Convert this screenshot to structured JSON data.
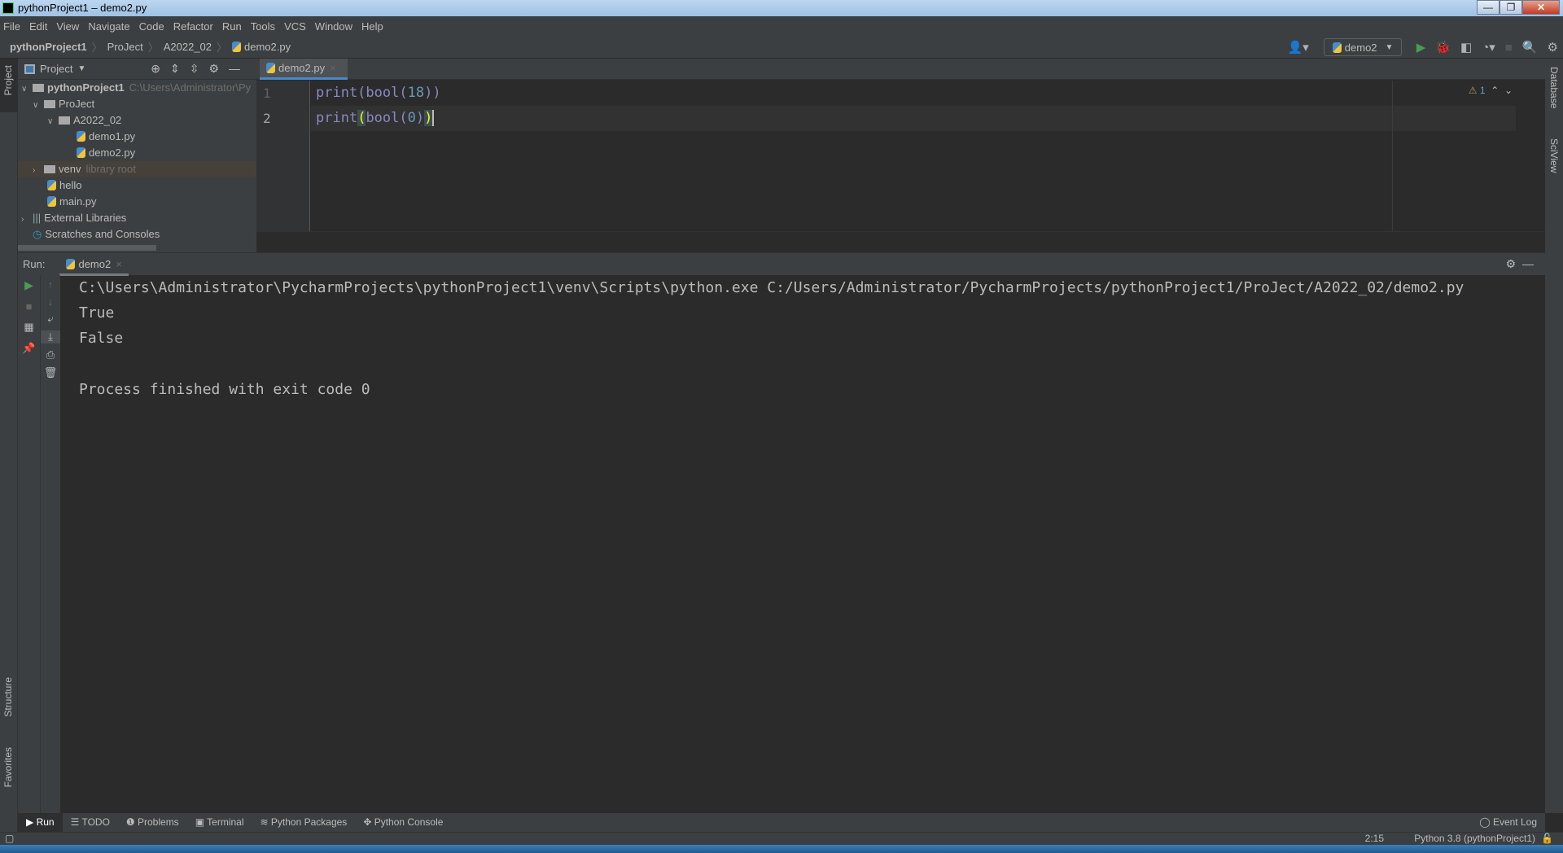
{
  "window": {
    "title": "pythonProject1 – demo2.py",
    "minimize": "—",
    "restore": "❐",
    "close": "✕"
  },
  "menu": [
    "File",
    "Edit",
    "View",
    "Navigate",
    "Code",
    "Refactor",
    "Run",
    "Tools",
    "VCS",
    "Window",
    "Help"
  ],
  "breadcrumb": [
    "pythonProject1",
    "ProJect",
    "A2022_02",
    "demo2.py"
  ],
  "toolbar": {
    "run_config": "demo2"
  },
  "project": {
    "title": "Project",
    "tree": [
      {
        "label": "pythonProject1",
        "hint": "C:\\Users\\Administrator\\Py"
      },
      {
        "label": "ProJect"
      },
      {
        "label": "A2022_02"
      },
      {
        "label": "demo1.py"
      },
      {
        "label": "demo2.py"
      },
      {
        "label": "venv",
        "hint": "library root"
      },
      {
        "label": "hello"
      },
      {
        "label": "main.py"
      },
      {
        "label": "External Libraries"
      },
      {
        "label": "Scratches and Consoles"
      }
    ]
  },
  "editor": {
    "tab": "demo2.py",
    "warnings": "1",
    "lines": [
      {
        "n": "1",
        "pre": "print(bool(",
        "arg": "18",
        "post": "))"
      },
      {
        "n": "2",
        "pre": "print",
        "open": "(",
        "mid": "bool(",
        "arg": "0",
        "close1": ")",
        "close2": ")"
      }
    ]
  },
  "run": {
    "label": "Run:",
    "tab": "demo2",
    "output": [
      "C:\\Users\\Administrator\\PycharmProjects\\pythonProject1\\venv\\Scripts\\python.exe C:/Users/Administrator/PycharmProjects/pythonProject1/ProJect/A2022_02/demo2.py",
      "True",
      "False",
      "",
      "Process finished with exit code 0"
    ]
  },
  "stripes": {
    "left": [
      "Project",
      "Structure",
      "Favorites"
    ],
    "right": [
      "Database",
      "SciView"
    ]
  },
  "bottom_tools": [
    "Run",
    "TODO",
    "Problems",
    "Terminal",
    "Python Packages",
    "Python Console"
  ],
  "event_log": "Event Log",
  "status": {
    "position": "2:15",
    "interpreter": "Python 3.8 (pythonProject1)"
  }
}
